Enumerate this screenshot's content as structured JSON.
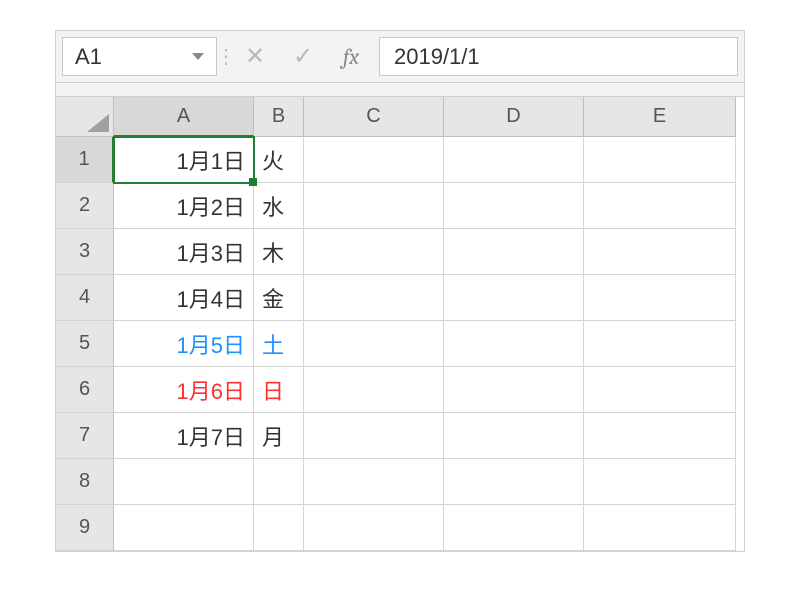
{
  "nameBox": {
    "cellRef": "A1"
  },
  "formulaBar": {
    "fxLabel": "fx",
    "value": "2019/1/1"
  },
  "columns": [
    "A",
    "B",
    "C",
    "D",
    "E"
  ],
  "rows": [
    "1",
    "2",
    "3",
    "4",
    "5",
    "6",
    "7",
    "8",
    "9"
  ],
  "activeCol": "A",
  "activeRow": "1",
  "cells": {
    "A1": {
      "text": "1月1日",
      "align": "right",
      "color": "default",
      "selected": true
    },
    "B1": {
      "text": "火",
      "align": "left",
      "color": "default"
    },
    "A2": {
      "text": "1月2日",
      "align": "right",
      "color": "default"
    },
    "B2": {
      "text": "水",
      "align": "left",
      "color": "default"
    },
    "A3": {
      "text": "1月3日",
      "align": "right",
      "color": "default"
    },
    "B3": {
      "text": "木",
      "align": "left",
      "color": "default"
    },
    "A4": {
      "text": "1月4日",
      "align": "right",
      "color": "default"
    },
    "B4": {
      "text": "金",
      "align": "left",
      "color": "default"
    },
    "A5": {
      "text": "1月5日",
      "align": "right",
      "color": "blue"
    },
    "B5": {
      "text": "土",
      "align": "left",
      "color": "blue"
    },
    "A6": {
      "text": "1月6日",
      "align": "right",
      "color": "red"
    },
    "B6": {
      "text": "日",
      "align": "left",
      "color": "red"
    },
    "A7": {
      "text": "1月7日",
      "align": "right",
      "color": "default"
    },
    "B7": {
      "text": "月",
      "align": "left",
      "color": "default"
    }
  }
}
